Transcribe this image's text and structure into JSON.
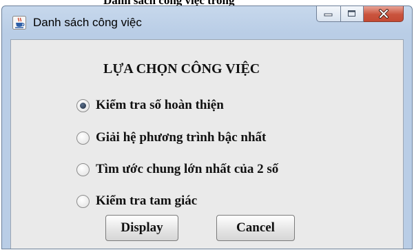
{
  "background_caption": "Danh sách công việc trong",
  "window": {
    "title": "Danh sách công việc",
    "app_icon": "java-cup-icon",
    "caption_buttons": [
      "minimize-icon",
      "maximize-icon",
      "close-icon"
    ]
  },
  "form": {
    "heading": "LỰA CHỌN CÔNG VIỆC",
    "options": [
      {
        "label": "Kiểm tra số hoàn thiện",
        "checked": true
      },
      {
        "label": "Giải hệ phương trình bậc nhất",
        "checked": false
      },
      {
        "label": "Tìm ước chung lớn nhất của 2 số",
        "checked": false
      },
      {
        "label": "Kiểm tra tam giác",
        "checked": false
      }
    ],
    "display_label": "Display",
    "cancel_label": "Cancel"
  },
  "colors": {
    "frame": "#b9cde6",
    "client": "#eaeaea",
    "close_button": "#c9533d"
  }
}
